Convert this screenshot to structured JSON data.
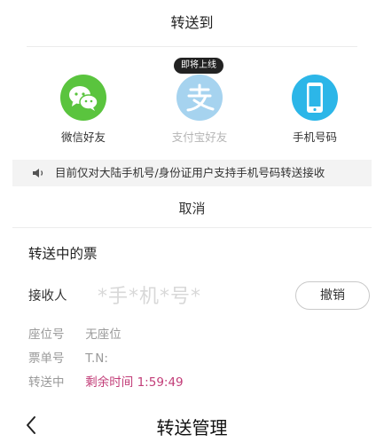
{
  "sheet": {
    "title": "转送到",
    "options": [
      {
        "label": "微信好友",
        "icon": "wechat-icon",
        "color": "#5ac43e"
      },
      {
        "label": "支付宝好友",
        "icon": "alipay-icon",
        "color": "#a6d3ef",
        "badge": "即将上线"
      },
      {
        "label": "手机号码",
        "icon": "phone-icon",
        "color": "#2cb6e8"
      }
    ],
    "notice": "目前仅对大陆手机号/身份证用户支持手机号码转送接收",
    "cancel": "取消"
  },
  "transfer": {
    "section_title": "转送中的票",
    "receiver_label": "接收人",
    "receiver_value": "*手*机*号*",
    "revoke_label": "撤销",
    "seat_label": "座位号",
    "seat_value": "无座位",
    "ticket_label": "票单号",
    "ticket_value": "T.N:",
    "status_label": "转送中",
    "status_value": "剩余时间 1:59:49",
    "accent_color": "#c23d78"
  },
  "nav": {
    "title": "转送管理"
  }
}
